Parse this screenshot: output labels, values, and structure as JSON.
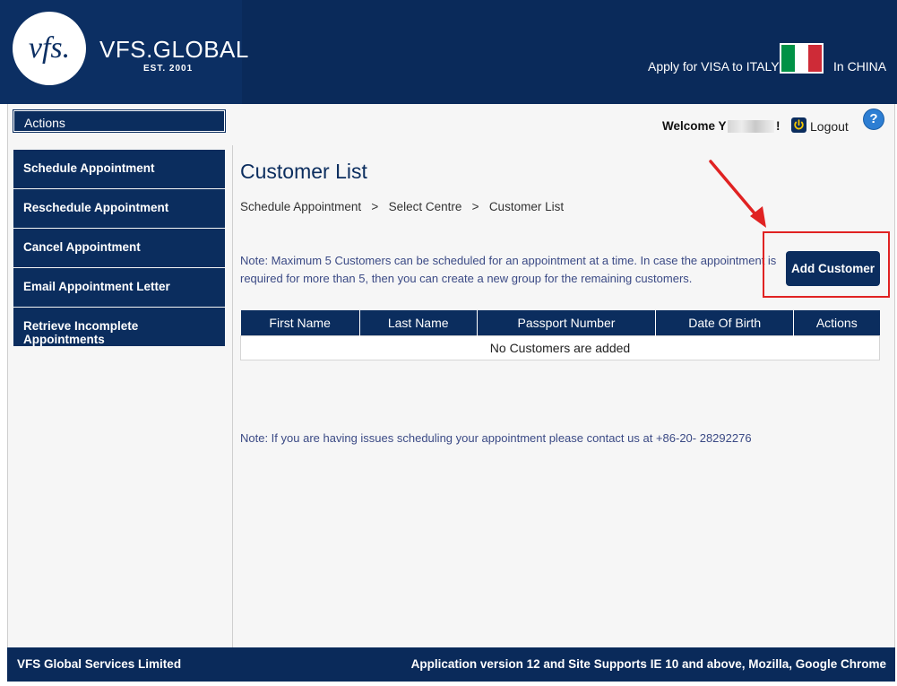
{
  "header": {
    "logo_text": "VFS.GLOBAL",
    "logo_est": "EST. 2001",
    "logo_monogram": "vfs.",
    "apply_text": "Apply for VISA to ITALY",
    "in_text": "In CHINA",
    "flag_colors": [
      "#009246",
      "#ffffff",
      "#ce2b37"
    ]
  },
  "sidebar": {
    "heading": "Actions",
    "items": [
      {
        "label": "Schedule Appointment"
      },
      {
        "label": "Reschedule Appointment"
      },
      {
        "label": "Cancel Appointment"
      },
      {
        "label": "Email Appointment Letter"
      },
      {
        "label": "Retrieve Incomplete Appointments"
      }
    ]
  },
  "topbar": {
    "welcome": "Welcome Y",
    "welcome_suffix": "!",
    "logout": "Logout",
    "help": "?"
  },
  "main": {
    "title": "Customer List",
    "breadcrumbs": [
      "Schedule Appointment",
      "Select Centre",
      "Customer List"
    ],
    "breadcrumb_sep": ">",
    "note_top": "Note: Maximum 5 Customers can be scheduled for an appointment at a time. In case the appointment is required for more than 5, then you can create a new group for the remaining customers.",
    "add_button": "Add Customer",
    "table": {
      "headers": [
        "First Name",
        "Last Name",
        "Passport Number",
        "Date Of Birth",
        "Actions"
      ],
      "empty_message": "No Customers are added"
    },
    "note_bottom": "Note: If you are having issues scheduling your appointment please contact us at +86-20- 28292276"
  },
  "footer": {
    "company": "VFS Global Services Limited",
    "version": "Application version 12 and Site Supports IE 10 and above, Mozilla, Google Chrome"
  },
  "colors": {
    "navy": "#0b2d5e",
    "annotation_red": "#e02222",
    "note_text": "#3b4a85"
  }
}
